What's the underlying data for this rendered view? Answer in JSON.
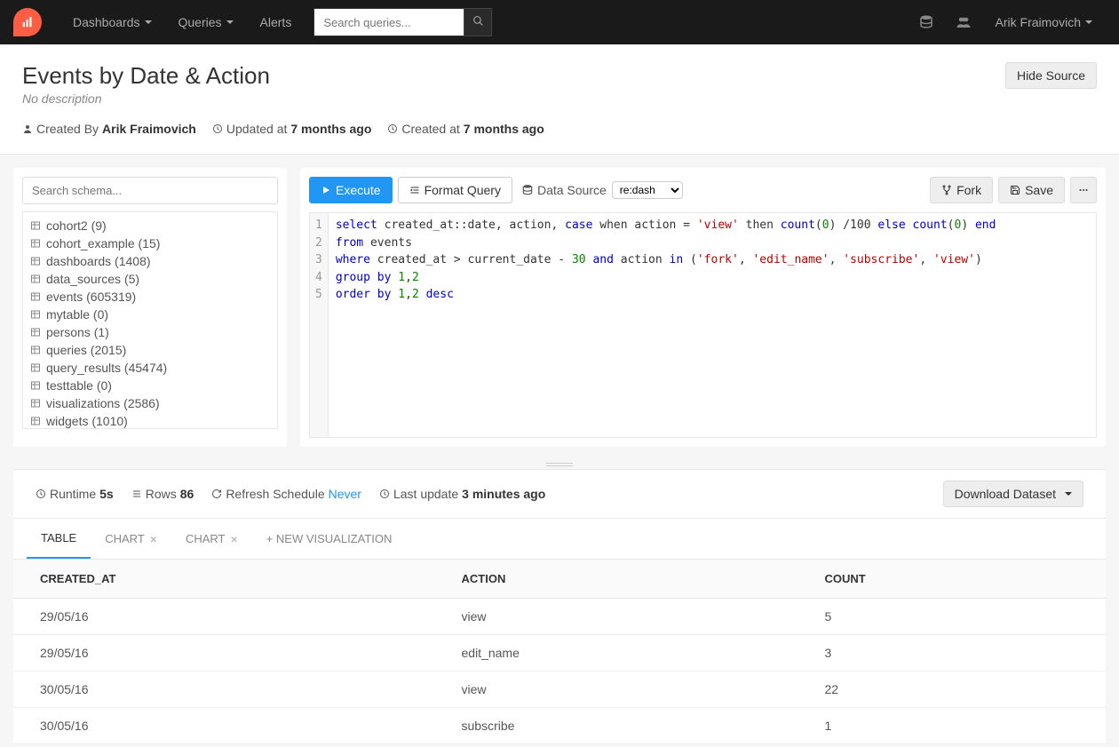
{
  "nav": {
    "dashboards": "Dashboards",
    "queries": "Queries",
    "alerts": "Alerts",
    "search_placeholder": "Search queries...",
    "username": "Arik Fraimovich"
  },
  "header": {
    "title": "Events by Date & Action",
    "no_desc": "No description",
    "hide_source": "Hide Source",
    "created_by_label": "Created By ",
    "created_by_name": "Arik Fraimovich",
    "updated_label": "Updated at ",
    "updated_value": "7 months ago",
    "created_label": "Created at ",
    "created_value": "7 months ago"
  },
  "schema": {
    "search_placeholder": "Search schema...",
    "items": [
      "cohort2 (9)",
      "cohort_example (15)",
      "dashboards (1408)",
      "data_sources (5)",
      "events (605319)",
      "mytable (0)",
      "persons (1)",
      "queries (2015)",
      "query_results (45474)",
      "testtable (0)",
      "visualizations (2586)",
      "widgets (1010)"
    ]
  },
  "toolbar": {
    "execute": "Execute",
    "format": "Format Query",
    "datasource_label": "Data Source",
    "datasource_value": "re:dash",
    "fork": "Fork",
    "save": "Save"
  },
  "query": {
    "line1": {
      "p1": "select",
      "p2": " created_at::date, action, ",
      "p3": "case",
      "p4": " when action = ",
      "p5": "'view'",
      "p6": " then ",
      "p7": "count",
      "p8": "(",
      "p9": "0",
      "p10": ") /100 ",
      "p11": "else",
      "p12": " ",
      "p13": "count",
      "p14": "(",
      "p15": "0",
      "p16": ") ",
      "p17": "end"
    },
    "line2": {
      "p1": "from",
      "p2": " events"
    },
    "line3": {
      "p1": "where",
      "p2": " created_at > current_date - ",
      "p3": "30",
      "p4": " ",
      "p5": "and",
      "p6": " action ",
      "p7": "in",
      "p8": " (",
      "p9": "'fork'",
      "p10": ", ",
      "p11": "'edit_name'",
      "p12": ", ",
      "p13": "'subscribe'",
      "p14": ", ",
      "p15": "'view'",
      "p16": ")"
    },
    "line4": {
      "p1": "group",
      "p2": " ",
      "p3": "by",
      "p4": " ",
      "p5": "1",
      "p6": ",",
      "p7": "2"
    },
    "line5": {
      "p1": "order",
      "p2": " ",
      "p3": "by",
      "p4": " ",
      "p5": "1",
      "p6": ",",
      "p7": "2",
      "p8": " ",
      "p9": "desc"
    },
    "ln1": "1",
    "ln2": "2",
    "ln3": "3",
    "ln4": "4",
    "ln5": "5"
  },
  "results": {
    "runtime_label": "Runtime ",
    "runtime_value": "5s",
    "rows_label": "Rows ",
    "rows_value": "86",
    "refresh_label": "Refresh Schedule ",
    "refresh_value": "Never",
    "lastupdate_label": "Last update ",
    "lastupdate_value": "3 minutes ago",
    "download": "Download Dataset"
  },
  "tabs": {
    "table": "TABLE",
    "chart1": "CHART",
    "chart2": "CHART",
    "newvis": "+ NEW VISUALIZATION"
  },
  "table": {
    "col1": "CREATED_AT",
    "col2": "ACTION",
    "col3": "COUNT",
    "rows": [
      {
        "c1": "29/05/16",
        "c2": "view",
        "c3": "5"
      },
      {
        "c1": "29/05/16",
        "c2": "edit_name",
        "c3": "3"
      },
      {
        "c1": "30/05/16",
        "c2": "view",
        "c3": "22"
      },
      {
        "c1": "30/05/16",
        "c2": "subscribe",
        "c3": "1"
      }
    ]
  }
}
